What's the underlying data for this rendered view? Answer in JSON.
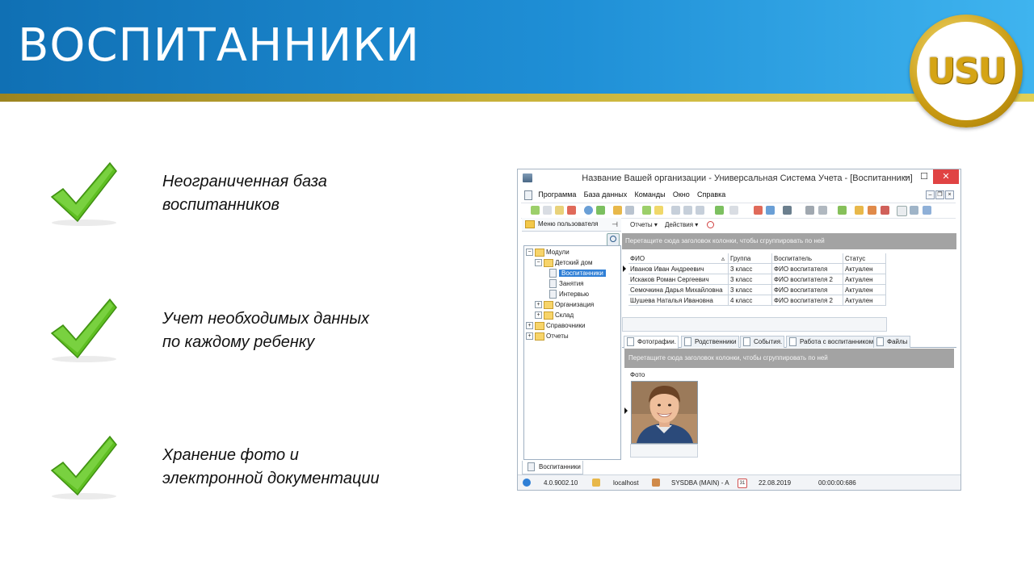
{
  "slide": {
    "title": "ВОСПИТАННИКИ",
    "logo_text": "USU",
    "colors": {
      "banner": "#1f8fd6",
      "stripe": "#c9b23a",
      "check": "#5fbf22"
    },
    "features": [
      {
        "line1": "Неограниченная  база",
        "line2": "воспитанников"
      },
      {
        "line1": "Учет необходимых данных",
        "line2": "по каждому ребенку"
      },
      {
        "line1": "Хранение фото и",
        "line2": "электронной документации"
      }
    ]
  },
  "app": {
    "title": "Название Вашей организации - Универсальная Система Учета - [Воспитанники]",
    "window_buttons": {
      "minimize": "–",
      "maximize": "☐",
      "close": "✕"
    },
    "menu": [
      "Программа",
      "База данных",
      "Команды",
      "Окно",
      "Справка"
    ],
    "left_panel": {
      "header": "Меню пользователя",
      "pin": "⊣",
      "tree": [
        {
          "label": "Модули",
          "expander": "−",
          "depth": 0
        },
        {
          "label": "Детский дом",
          "expander": "−",
          "depth": 1
        },
        {
          "label": "Воспитанники",
          "depth": 2,
          "selected": true
        },
        {
          "label": "Занятия",
          "depth": 2
        },
        {
          "label": "Интервью",
          "depth": 2
        },
        {
          "label": "Организация",
          "expander": "+",
          "depth": 1
        },
        {
          "label": "Склад",
          "expander": "+",
          "depth": 1
        },
        {
          "label": "Справочники",
          "expander": "+",
          "depth": 0
        },
        {
          "label": "Отчеты",
          "expander": "+",
          "depth": 0
        }
      ]
    },
    "right_toolbar": {
      "reports": "Отчеты ▾",
      "actions": "Действия ▾"
    },
    "group_hint": "Перетащите сюда заголовок колонки, чтобы сгруппировать по ней",
    "grid": {
      "sort_marker": "▵",
      "columns": [
        "ФИО",
        "Группа",
        "Воспитатель",
        "Статус"
      ],
      "rows": [
        [
          "Иванов Иван Андреевич",
          "3 класс",
          "ФИО воспитателя",
          "Актуален"
        ],
        [
          "Искаков Роман Сергеевич",
          "3 класс",
          "ФИО воспитателя 2",
          "Актуален"
        ],
        [
          "Семочкина Дарья Михайловна",
          "3 класс",
          "ФИО воспитателя",
          "Актуален"
        ],
        [
          "Шушева Наталья Ивановна",
          "4 класс",
          "ФИО воспитателя 2",
          "Актуален"
        ]
      ]
    },
    "detail_tabs": [
      "Фотографии.",
      "Родственники",
      "События.",
      "Работа с воспитанником",
      "Файлы"
    ],
    "detail_group_hint": "Перетащите сюда заголовок колонки, чтобы сгруппировать по ней",
    "photo_column": "Фото",
    "bottom_tab": "Воспитанники",
    "status": {
      "version": "4.0.9002.10",
      "server": "localhost",
      "user": "SYSDBA (MAIN) - A",
      "calendar_day": "31",
      "date": "22.08.2019",
      "timer": "00:00:00:686"
    }
  }
}
